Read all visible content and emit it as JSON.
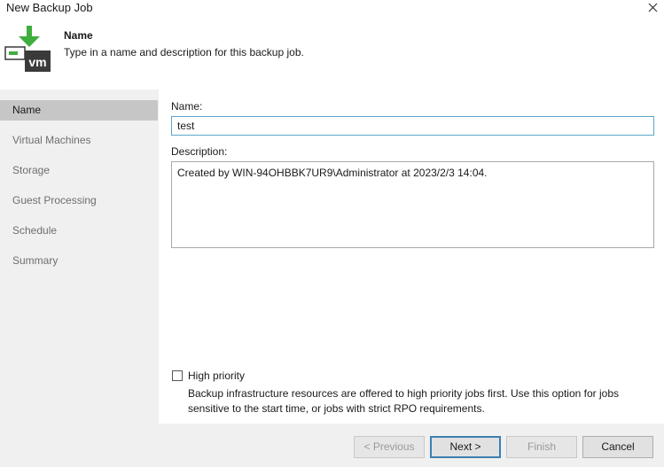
{
  "window": {
    "title": "New Backup Job"
  },
  "header": {
    "step_title": "Name",
    "step_description": "Type in a name and description for this backup job.",
    "icon_label": "vm"
  },
  "sidebar": {
    "items": [
      {
        "label": "Name",
        "active": true
      },
      {
        "label": "Virtual Machines",
        "active": false
      },
      {
        "label": "Storage",
        "active": false
      },
      {
        "label": "Guest Processing",
        "active": false
      },
      {
        "label": "Schedule",
        "active": false
      },
      {
        "label": "Summary",
        "active": false
      }
    ]
  },
  "form": {
    "name_label": "Name:",
    "name_value": "test",
    "description_label": "Description:",
    "description_value": "Created by WIN-94OHBBK7UR9\\Administrator at 2023/2/3 14:04.",
    "high_priority_label": "High priority",
    "high_priority_checked": false,
    "high_priority_hint": "Backup infrastructure resources are offered to high priority jobs first. Use this option for jobs sensitive to the start time, or jobs with strict RPO requirements."
  },
  "footer": {
    "previous_label": "< Previous",
    "next_label": "Next >",
    "finish_label": "Finish",
    "cancel_label": "Cancel"
  },
  "colors": {
    "accent_border": "#5aa7c8",
    "active_sidebar": "#c6c6c6",
    "icon_green": "#3fae3f",
    "icon_dark": "#3a3a3a"
  }
}
